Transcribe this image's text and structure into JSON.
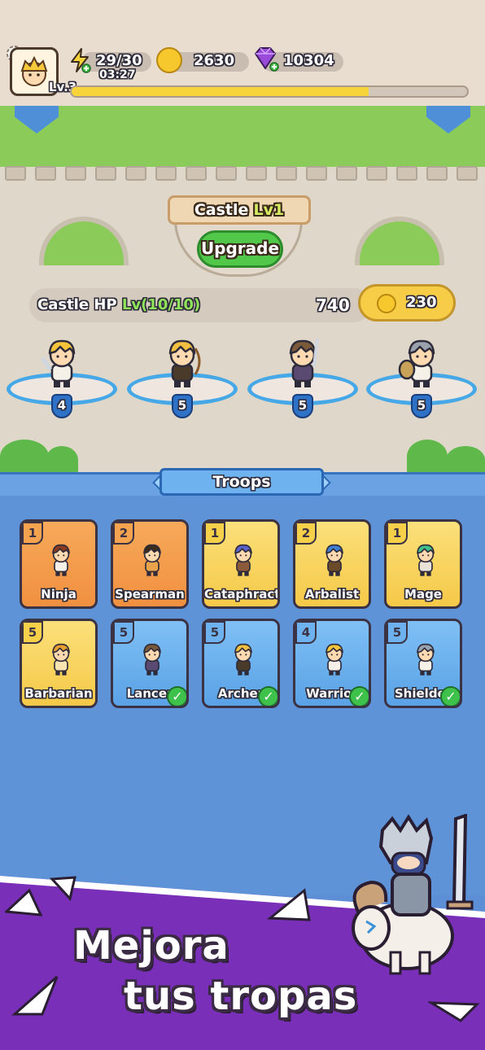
{
  "topbar": {
    "energy": "29/30",
    "energy_timer": "03:27",
    "coins": "2630",
    "gems": "10304",
    "player_level": "Lv.3",
    "xp_progress": 0.75
  },
  "castle": {
    "title": "Castle",
    "level": "Lv1",
    "upgrade_label": "Upgrade",
    "hp_label": "Castle HP",
    "hp_level": "Lv(10/10)",
    "hp_value": "740",
    "upgrade_cost": "230"
  },
  "deployed": [
    {
      "name": "Warrior",
      "level": "4"
    },
    {
      "name": "Archer",
      "level": "5"
    },
    {
      "name": "Lancer",
      "level": "5"
    },
    {
      "name": "Shielder",
      "level": "5"
    }
  ],
  "troops_title": "Troops",
  "troops": [
    {
      "name": "Ninja",
      "level": "1",
      "color": "orange",
      "selected": false,
      "hair": "#8a3a1e",
      "outfit": "#f6f1e8"
    },
    {
      "name": "Spearman",
      "level": "2",
      "color": "orange",
      "selected": false,
      "hair": "#3c2a1a",
      "outfit": "#e9a34b"
    },
    {
      "name": "Cataphract",
      "level": "1",
      "color": "yellow",
      "selected": false,
      "hair": "#5a62c8",
      "outfit": "#8a5a3a"
    },
    {
      "name": "Arbalist",
      "level": "2",
      "color": "yellow",
      "selected": false,
      "hair": "#3f7fd6",
      "outfit": "#6b4a2a"
    },
    {
      "name": "Mage",
      "level": "1",
      "color": "yellow",
      "selected": false,
      "hair": "#3fbf8a",
      "outfit": "#e9e2d8"
    },
    {
      "name": "Barbarian",
      "level": "5",
      "color": "yellow",
      "selected": false,
      "hair": "#e9a030",
      "outfit": "#f6e3b0"
    },
    {
      "name": "Lancer",
      "level": "5",
      "color": "blue",
      "selected": true,
      "hair": "#7a5a3a",
      "outfit": "#5a4a72"
    },
    {
      "name": "Archer",
      "level": "5",
      "color": "blue",
      "selected": true,
      "hair": "#f2c040",
      "outfit": "#4a3a2a"
    },
    {
      "name": "Warrior",
      "level": "4",
      "color": "blue",
      "selected": true,
      "hair": "#f6c43a",
      "outfit": "#f6f1e8"
    },
    {
      "name": "Shielder",
      "level": "5",
      "color": "blue",
      "selected": true,
      "hair": "#9aa2ae",
      "outfit": "#f6f1e8"
    }
  ],
  "promo": {
    "line1": "Mejora",
    "line2": "tus tropas"
  },
  "colors": {
    "accent_green": "#51c84a",
    "coin_gold": "#f6c82e",
    "gem_purple": "#9a4ad8",
    "panel_blue": "#5f93d8",
    "promo_purple": "#7a2fb8"
  }
}
